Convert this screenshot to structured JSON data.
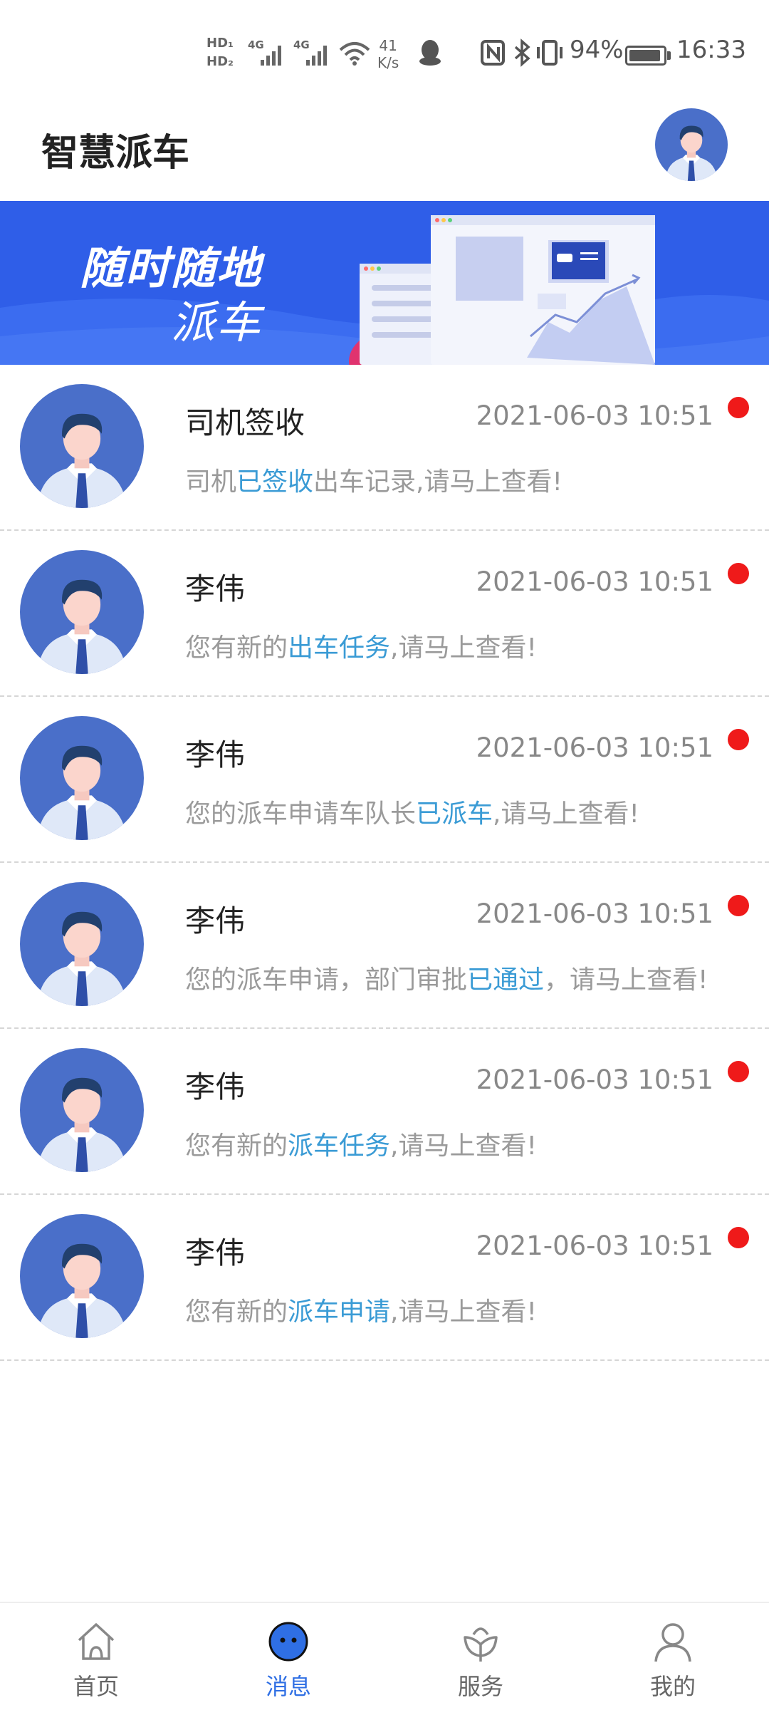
{
  "status_bar": {
    "hd1": "HD₁",
    "hd2": "HD₂",
    "net1": "4G",
    "net2": "4G",
    "speed_value": "41",
    "speed_unit": "K/s",
    "battery": "94%",
    "battery_level": 0.94,
    "time": "16:33"
  },
  "header": {
    "title": "智慧派车"
  },
  "banner": {
    "line1": "随时随地",
    "line2": "派车"
  },
  "messages": [
    {
      "sender": "司机签收",
      "time": "2021-06-03 10:51",
      "text_before": "司机",
      "text_highlight": "已签收",
      "text_after": "出车记录,请马上查看!",
      "unread": true
    },
    {
      "sender": "李伟",
      "time": "2021-06-03 10:51",
      "text_before": "您有新的",
      "text_highlight": "出车任务",
      "text_after": ",请马上查看!",
      "unread": true
    },
    {
      "sender": "李伟",
      "time": "2021-06-03 10:51",
      "text_before": "您的派车申请车队长",
      "text_highlight": "已派车",
      "text_after": ",请马上查看!",
      "unread": true
    },
    {
      "sender": "李伟",
      "time": "2021-06-03 10:51",
      "text_before": "您的派车申请，部门审批",
      "text_highlight": "已通过",
      "text_after": "，请马上查看!",
      "unread": true
    },
    {
      "sender": "李伟",
      "time": "2021-06-03 10:51",
      "text_before": "您有新的",
      "text_highlight": "派车任务",
      "text_after": ",请马上查看!",
      "unread": true
    },
    {
      "sender": "李伟",
      "time": "2021-06-03 10:51",
      "text_before": "您有新的",
      "text_highlight": "派车申请",
      "text_after": ",请马上查看!",
      "unread": true
    }
  ],
  "bottom_nav": [
    {
      "label": "首页",
      "icon": "home-icon",
      "active": false
    },
    {
      "label": "消息",
      "icon": "message-icon",
      "active": true
    },
    {
      "label": "服务",
      "icon": "service-icon",
      "active": false
    },
    {
      "label": "我的",
      "icon": "profile-icon",
      "active": false
    }
  ],
  "colors": {
    "accent": "#2f6fe4",
    "highlight": "#3a9bd5",
    "unread": "#ef1a1a",
    "banner": "#2f5ee8"
  }
}
